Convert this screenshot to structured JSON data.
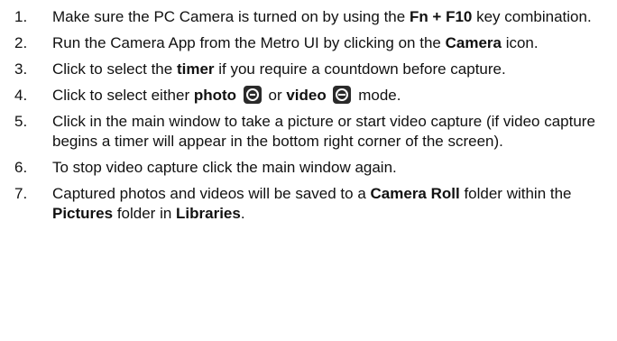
{
  "steps": [
    {
      "number": "1.",
      "t1": "Make sure the PC Camera is turned on by using the ",
      "b1": "Fn + F10",
      "t2": " key combination."
    },
    {
      "number": "2.",
      "t1": "Run the Camera App from the Metro UI by clicking on the ",
      "b1": "Camera",
      "t2": " icon."
    },
    {
      "number": "3.",
      "t1": "Click to select the ",
      "b1": "timer",
      "t2": " if you require a countdown before capture."
    },
    {
      "number": "4.",
      "t1": "Click to select either ",
      "b1": "photo",
      "icon1": "camera-photo-icon",
      "t2": " or ",
      "b2": "video",
      "icon2": "camera-video-icon",
      "t3": " mode."
    },
    {
      "number": "5.",
      "t1": "Click in the main window to take a picture or start video capture (if video capture begins a timer will appear in the bottom right corner of the screen)."
    },
    {
      "number": "6.",
      "t1": "To stop video capture click the main window again."
    },
    {
      "number": "7.",
      "t1": "Captured photos and videos will be saved to a ",
      "b1": "Camera Roll",
      "t2": " folder within the ",
      "b2": "Pictures",
      "t3": " folder in ",
      "b3": "Libraries",
      "t4": "."
    }
  ]
}
